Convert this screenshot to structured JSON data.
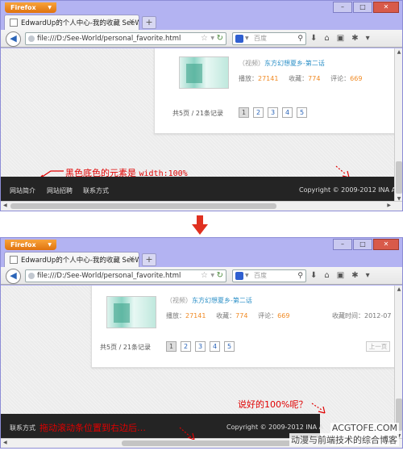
{
  "browser": {
    "app_button": "Firefox",
    "tab_title": "EdwardUp的个人中心-我的收藏 SeeW...",
    "url": "file:///D:/See-World/personal_favorite.html",
    "search_placeholder": "百度",
    "new_tab": "+"
  },
  "shot1": {
    "item": {
      "tag": "（视频）",
      "title": "东方幻想夏乡-第二话",
      "plays_label": "播放：",
      "plays": "27141",
      "favs_label": "收藏：",
      "favs": "774",
      "comments_label": "评论：",
      "comments": "669"
    },
    "pager": {
      "summary": "共5页 / 21条记录",
      "pages": [
        "1",
        "2",
        "3",
        "4",
        "5"
      ]
    },
    "footer": {
      "links": [
        "网站简介",
        "网站招聘",
        "联系方式"
      ],
      "copyright": "Copyright © 2009-2012 INA A"
    },
    "annotation_text": "黑色底色的元素是 ",
    "annotation_code": "width:100%"
  },
  "shot2": {
    "item": {
      "tag": "（视频）",
      "title": "东方幻想夏乡-第二话",
      "plays_label": "播放：",
      "plays": "27141",
      "favs_label": "收藏：",
      "favs": "774",
      "comments_label": "评论：",
      "comments": "669",
      "time_label": "收藏时间：2012-07"
    },
    "pager": {
      "summary": "共5页 / 21条记录",
      "pages": [
        "1",
        "2",
        "3",
        "4",
        "5"
      ],
      "prev": "上一页"
    },
    "footer": {
      "link": "联系方式",
      "copyright": "Copyright © 2009-2012 INA A"
    },
    "annotation_scroll": "拖动滚动条位置到右边后…",
    "annotation_question": "说好的100%呢？"
  },
  "watermark": {
    "site": "ACGTOFE.COM",
    "tagline": "动漫与前端技术的综合博客"
  },
  "colors": {
    "frame": "#b3b3f2",
    "footer": "#242424",
    "link": "#2a8fc7",
    "number": "#f08a24",
    "annotation": "#e00000"
  }
}
